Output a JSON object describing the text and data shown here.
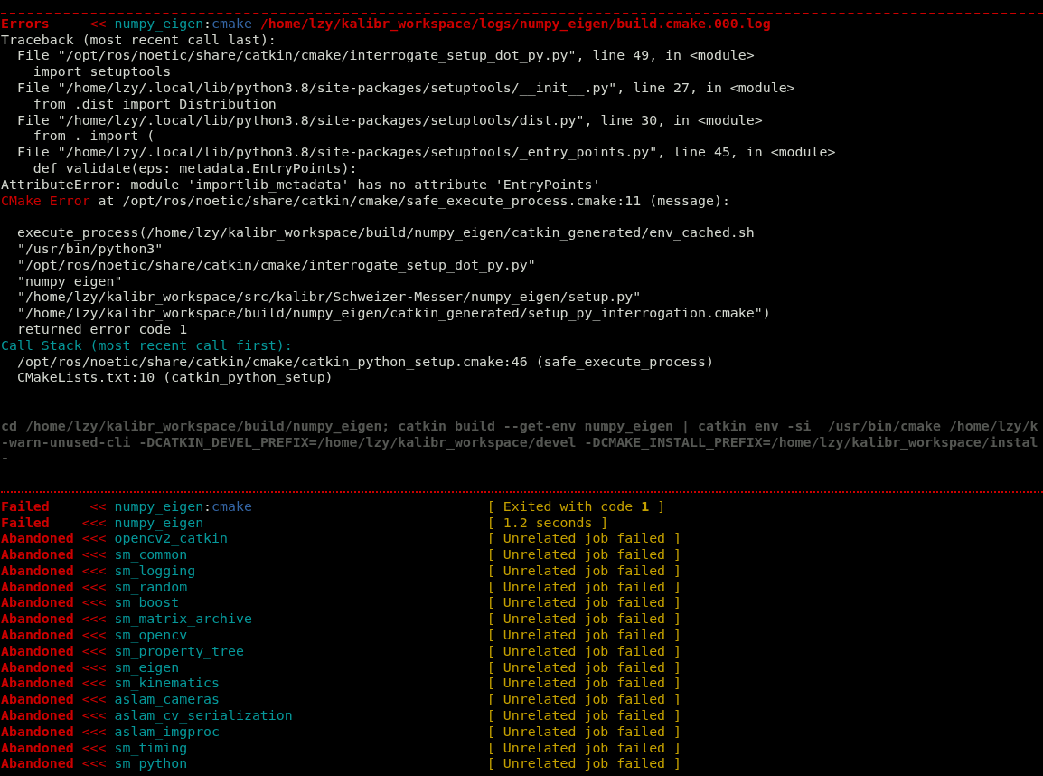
{
  "error_header": {
    "status": "Errors",
    "arrows": "<<",
    "package": "numpy_eigen",
    "separator": ":",
    "stage": "cmake",
    "log_path": "/home/lzy/kalibr_workspace/logs/numpy_eigen/build.cmake.000.log"
  },
  "log_lines": [
    {
      "kind": "plain",
      "text": "Traceback (most recent call last):"
    },
    {
      "kind": "plain",
      "text": "  File \"/opt/ros/noetic/share/catkin/cmake/interrogate_setup_dot_py.py\", line 49, in <module>"
    },
    {
      "kind": "plain",
      "text": "    import setuptools"
    },
    {
      "kind": "plain",
      "text": "  File \"/home/lzy/.local/lib/python3.8/site-packages/setuptools/__init__.py\", line 27, in <module>"
    },
    {
      "kind": "plain",
      "text": "    from .dist import Distribution"
    },
    {
      "kind": "plain",
      "text": "  File \"/home/lzy/.local/lib/python3.8/site-packages/setuptools/dist.py\", line 30, in <module>"
    },
    {
      "kind": "plain",
      "text": "    from . import ("
    },
    {
      "kind": "plain",
      "text": "  File \"/home/lzy/.local/lib/python3.8/site-packages/setuptools/_entry_points.py\", line 45, in <module>"
    },
    {
      "kind": "plain",
      "text": "    def validate(eps: metadata.EntryPoints):"
    },
    {
      "kind": "plain",
      "text": "AttributeError: module 'importlib_metadata' has no attribute 'EntryPoints'"
    },
    {
      "kind": "error",
      "label": "CMake Error",
      "text": " at /opt/ros/noetic/share/catkin/cmake/safe_execute_process.cmake:11 (message):"
    },
    {
      "kind": "blank"
    },
    {
      "kind": "plain",
      "text": "  execute_process(/home/lzy/kalibr_workspace/build/numpy_eigen/catkin_generated/env_cached.sh"
    },
    {
      "kind": "plain",
      "text": "  \"/usr/bin/python3\""
    },
    {
      "kind": "plain",
      "text": "  \"/opt/ros/noetic/share/catkin/cmake/interrogate_setup_dot_py.py\""
    },
    {
      "kind": "plain",
      "text": "  \"numpy_eigen\""
    },
    {
      "kind": "plain",
      "text": "  \"/home/lzy/kalibr_workspace/src/kalibr/Schweizer-Messer/numpy_eigen/setup.py\""
    },
    {
      "kind": "plain",
      "text": "  \"/home/lzy/kalibr_workspace/build/numpy_eigen/catkin_generated/setup_py_interrogation.cmake\")"
    },
    {
      "kind": "plain",
      "text": "  returned error code 1"
    },
    {
      "kind": "heading",
      "text": "Call Stack (most recent call first):"
    },
    {
      "kind": "plain",
      "text": "  /opt/ros/noetic/share/catkin/cmake/catkin_python_setup.cmake:46 (safe_execute_process)"
    },
    {
      "kind": "plain",
      "text": "  CMakeLists.txt:10 (catkin_python_setup)"
    },
    {
      "kind": "blank"
    },
    {
      "kind": "blank"
    },
    {
      "kind": "dim",
      "text": "cd /home/lzy/kalibr_workspace/build/numpy_eigen; catkin build --get-env numpy_eigen | catkin env -si  /usr/bin/cmake /home/lzy/k"
    },
    {
      "kind": "dim",
      "text": "-warn-unused-cli -DCATKIN_DEVEL_PREFIX=/home/lzy/kalibr_workspace/devel -DCMAKE_INSTALL_PREFIX=/home/lzy/kalibr_workspace/instal"
    },
    {
      "kind": "dim",
      "text": "-"
    },
    {
      "kind": "blank"
    }
  ],
  "summary": [
    {
      "status": "Failed",
      "arrows": "<<",
      "package": "numpy_eigen",
      "separator": ":",
      "stage": "cmake",
      "result": "[ Exited with code **1** ]"
    },
    {
      "status": "Failed",
      "arrows": "<<<",
      "package": "numpy_eigen",
      "result": "[ 1.2 seconds ]"
    },
    {
      "status": "Abandoned",
      "arrows": "<<<",
      "package": "opencv2_catkin",
      "result": "[ Unrelated job failed ]"
    },
    {
      "status": "Abandoned",
      "arrows": "<<<",
      "package": "sm_common",
      "result": "[ Unrelated job failed ]"
    },
    {
      "status": "Abandoned",
      "arrows": "<<<",
      "package": "sm_logging",
      "result": "[ Unrelated job failed ]"
    },
    {
      "status": "Abandoned",
      "arrows": "<<<",
      "package": "sm_random",
      "result": "[ Unrelated job failed ]"
    },
    {
      "status": "Abandoned",
      "arrows": "<<<",
      "package": "sm_boost",
      "result": "[ Unrelated job failed ]"
    },
    {
      "status": "Abandoned",
      "arrows": "<<<",
      "package": "sm_matrix_archive",
      "result": "[ Unrelated job failed ]"
    },
    {
      "status": "Abandoned",
      "arrows": "<<<",
      "package": "sm_opencv",
      "result": "[ Unrelated job failed ]"
    },
    {
      "status": "Abandoned",
      "arrows": "<<<",
      "package": "sm_property_tree",
      "result": "[ Unrelated job failed ]"
    },
    {
      "status": "Abandoned",
      "arrows": "<<<",
      "package": "sm_eigen",
      "result": "[ Unrelated job failed ]"
    },
    {
      "status": "Abandoned",
      "arrows": "<<<",
      "package": "sm_kinematics",
      "result": "[ Unrelated job failed ]"
    },
    {
      "status": "Abandoned",
      "arrows": "<<<",
      "package": "aslam_cameras",
      "result": "[ Unrelated job failed ]"
    },
    {
      "status": "Abandoned",
      "arrows": "<<<",
      "package": "aslam_cv_serialization",
      "result": "[ Unrelated job failed ]"
    },
    {
      "status": "Abandoned",
      "arrows": "<<<",
      "package": "aslam_imgproc",
      "result": "[ Unrelated job failed ]"
    },
    {
      "status": "Abandoned",
      "arrows": "<<<",
      "package": "sm_timing",
      "result": "[ Unrelated job failed ]"
    },
    {
      "status": "Abandoned",
      "arrows": "<<<",
      "package": "sm_python",
      "result": "[ Unrelated job failed ]"
    }
  ]
}
